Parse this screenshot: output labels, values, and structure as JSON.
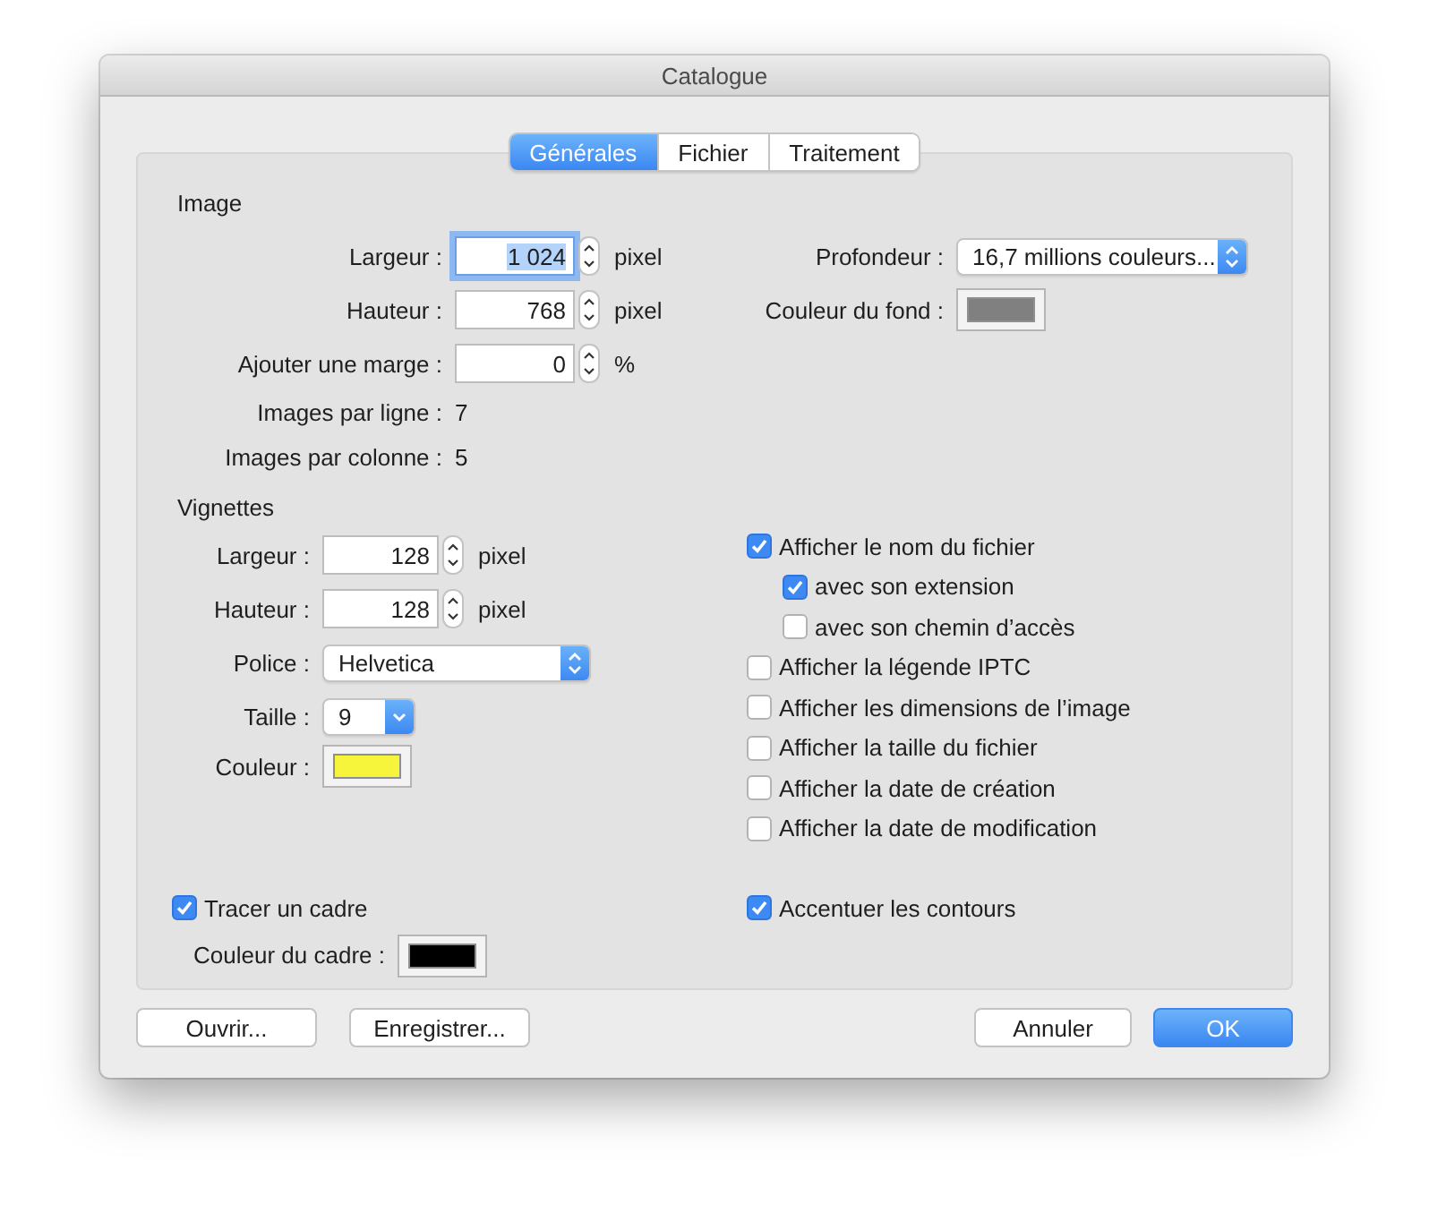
{
  "window": {
    "title": "Catalogue"
  },
  "tabs": [
    {
      "label": "Générales",
      "selected": true
    },
    {
      "label": "Fichier",
      "selected": false
    },
    {
      "label": "Traitement",
      "selected": false
    }
  ],
  "image": {
    "heading": "Image",
    "fields": [
      {
        "label": "Largeur :",
        "value": "1 024",
        "unit": "pixel",
        "focused": true
      },
      {
        "label": "Hauteur :",
        "value": "768",
        "unit": "pixel",
        "focused": false
      },
      {
        "label": "Ajouter une marge :",
        "value": "0",
        "unit": "%",
        "focused": false
      }
    ],
    "info": [
      {
        "label": "Images par ligne :",
        "value": "7"
      },
      {
        "label": "Images par colonne :",
        "value": "5"
      }
    ],
    "depth": {
      "label": "Profondeur :",
      "value": "16,7 millions couleurs..."
    },
    "background": {
      "label": "Couleur du fond :",
      "color": "#808080"
    }
  },
  "thumbnails": {
    "heading": "Vignettes",
    "fields": [
      {
        "label": "Largeur :",
        "value": "128",
        "unit": "pixel"
      },
      {
        "label": "Hauteur :",
        "value": "128",
        "unit": "pixel"
      }
    ],
    "font": {
      "label": "Police :",
      "value": "Helvetica"
    },
    "size": {
      "label": "Taille :",
      "value": "9"
    },
    "color": {
      "label": "Couleur :",
      "color": "#f7f43c"
    }
  },
  "options": [
    {
      "label": "Afficher le nom du fichier",
      "checked": true,
      "children": [
        {
          "label": "avec son extension",
          "checked": true
        },
        {
          "label": "avec son chemin d’accès",
          "checked": false
        }
      ]
    },
    {
      "label": "Afficher la légende IPTC",
      "checked": false
    },
    {
      "label": "Afficher les dimensions de l’image",
      "checked": false
    },
    {
      "label": "Afficher la taille du fichier",
      "checked": false
    },
    {
      "label": "Afficher la date de création",
      "checked": false
    },
    {
      "label": "Afficher la date de modification",
      "checked": false
    }
  ],
  "frame": {
    "draw": {
      "label": "Tracer un cadre",
      "checked": true
    },
    "color": {
      "label": "Couleur du cadre :",
      "color": "#000000"
    }
  },
  "sharpen": {
    "label": "Accentuer les contours",
    "checked": true
  },
  "buttons": [
    {
      "label": "Ouvrir...",
      "kind": "left"
    },
    {
      "label": "Enregistrer...",
      "kind": "left"
    },
    {
      "label": "Annuler",
      "kind": "right"
    },
    {
      "label": "OK",
      "kind": "default"
    }
  ]
}
